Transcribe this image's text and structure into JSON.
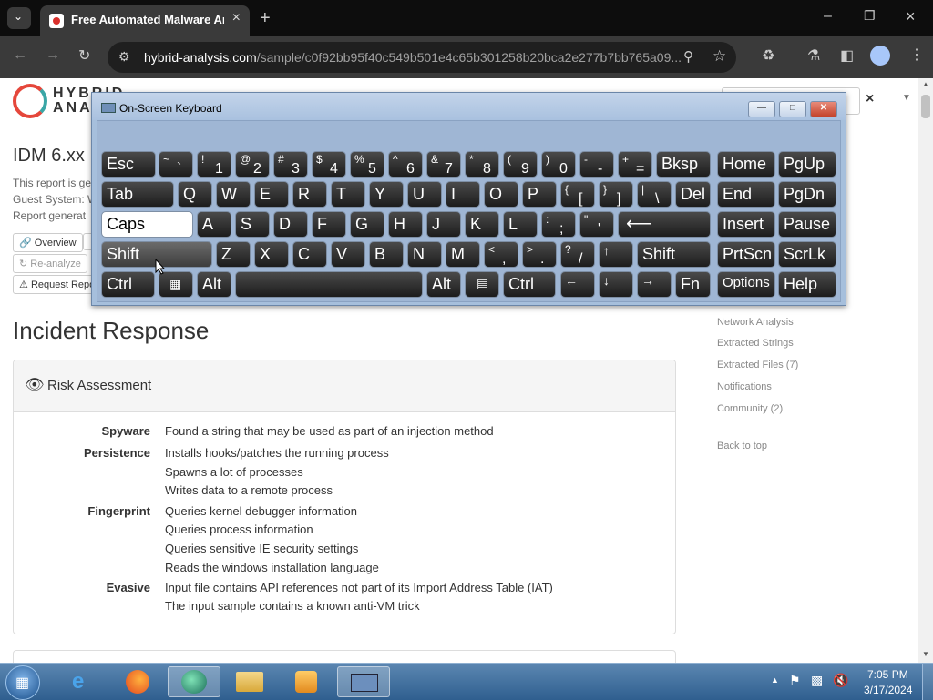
{
  "browser": {
    "tab_title": "Free Automated Malware Anal",
    "url_host": "hybrid-analysis.com",
    "url_path": "/sample/c0f92bb95f40c549b501e4c65b301258b20bca2e277b7bb765a09..."
  },
  "site": {
    "logo_line1": "HYBRID",
    "logo_line2": "ANA",
    "page_heading": "IDM 6.xx",
    "report_line1": "This report is ge",
    "report_line2": "Guest System: W",
    "report_line3": "Report generat",
    "btn_overview": "Overview",
    "btn_reanalyze": "Re-analyze",
    "btn_request_report": "Request Repo",
    "section_heading": "Incident Response",
    "panel_title": "Risk Assessment"
  },
  "risk": [
    {
      "label": "Spyware",
      "items": [
        "Found a string that may be used as part of an injection method"
      ]
    },
    {
      "label": "Persistence",
      "items": [
        "Installs hooks/patches the running process",
        "Spawns a lot of processes",
        "Writes data to a remote process"
      ]
    },
    {
      "label": "Fingerprint",
      "items": [
        "Queries kernel debugger information",
        "Queries process information",
        "Queries sensitive IE security settings",
        "Reads the windows installation language"
      ]
    },
    {
      "label": "Evasive",
      "items": [
        "Input file contains API references not part of its Import Address Table (IAT)",
        "The input sample contains a known anti-VM trick"
      ]
    }
  ],
  "sidebar": {
    "links": [
      "Network Analysis",
      "Extracted Strings",
      "Extracted Files (7)",
      "Notifications",
      "Community (2)"
    ],
    "back_to_top": "Back to top"
  },
  "osk": {
    "title": "On-Screen Keyboard",
    "keys": {
      "esc": "Esc",
      "bksp": "Bksp",
      "home": "Home",
      "pgup": "PgUp",
      "tab": "Tab",
      "del": "Del",
      "end": "End",
      "pgdn": "PgDn",
      "caps": "Caps",
      "insert": "Insert",
      "pause": "Pause",
      "shift": "Shift",
      "prtscn": "PrtScn",
      "scrlk": "ScrLk",
      "ctrl": "Ctrl",
      "alt": "Alt",
      "fn": "Fn",
      "options": "Options",
      "help": "Help",
      "row1_top": [
        "~",
        "!",
        "@",
        "#",
        "$",
        "%",
        "^",
        "&",
        "*",
        "(",
        ")",
        "-",
        "+"
      ],
      "row1_bottom": [
        "`",
        "1",
        "2",
        "3",
        "4",
        "5",
        "6",
        "7",
        "8",
        "9",
        "0",
        "-",
        "="
      ],
      "row2": [
        "Q",
        "W",
        "E",
        "R",
        "T",
        "Y",
        "U",
        "I",
        "O",
        "P"
      ],
      "row2_punct_top": [
        "{",
        "}",
        "|"
      ],
      "row2_punct_bottom": [
        "[",
        "]",
        "\\"
      ],
      "row3": [
        "A",
        "S",
        "D",
        "F",
        "G",
        "H",
        "J",
        "K",
        "L"
      ],
      "row3_punct_top": [
        ":",
        "\""
      ],
      "row3_punct_bottom": [
        ";",
        "'"
      ],
      "row4": [
        "Z",
        "X",
        "C",
        "V",
        "B",
        "N",
        "M"
      ],
      "row4_punct_top": [
        "<",
        ">",
        "?"
      ],
      "row4_punct_bottom": [
        ",",
        ".",
        "/"
      ],
      "arrows": [
        "↑",
        "←",
        "↓",
        "→"
      ]
    }
  },
  "taskbar": {
    "time": "7:05 PM",
    "date": "3/17/2024"
  }
}
